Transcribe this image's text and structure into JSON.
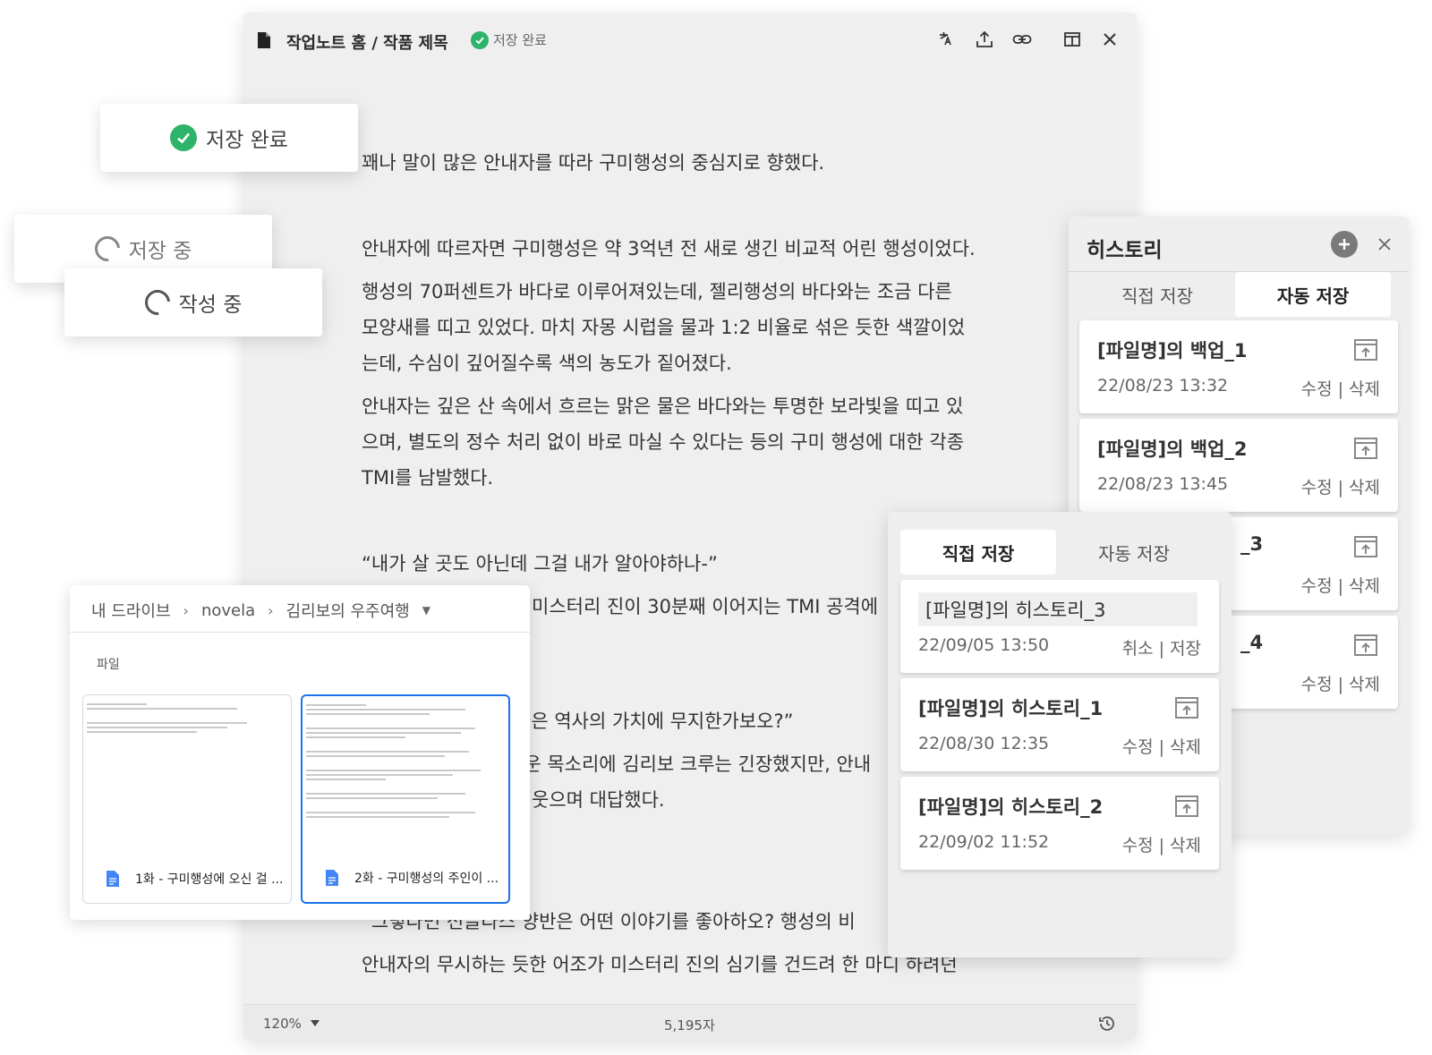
{
  "editor": {
    "title": "작업노트 홈 / 작품 제목",
    "save_status": "저장 완료",
    "paragraphs": [
      "꽤나 말이 많은 안내자를 따라 구미행성의 중심지로 향했다.",
      "",
      "안내자에 따르자면 구미행성은 약 3억년 전 새로 생긴 비교적 어린 행성이었다.",
      "행성의 70퍼센트가 바다로 이루어져있는데, 젤리행성의 바다와는 조금 다른",
      "모양새를 띠고 있었다. 마치 자몽 시럽을 물과 1:2 비율로 섞은 듯한 색깔이었",
      "는데, 수심이 깊어질수록 색의 농도가 짙어졌다.",
      "안내자는 깊은 산 속에서 흐르는 맑은 물은 바다와는 투명한 보라빛을 띠고 있",
      "으며, 별도의 정수 처리 없이 바로 마실 수 있다는 등의 구미 행성에 대한 각종",
      "TMI를 남발했다.",
      "",
      "“내가 살 곳도 아닌데 그걸 내가 알아야하나-”",
      "미스터리 진이 30분째 이어지는 TMI 공격에",
      "",
      "",
      "좋은 역사의 가치에 무지한가보오?”",
      "무운 목소리에 김리보 크루는 긴장했지만, 안내",
      "웃으며 대답했다.",
      "",
      "",
      "“그렇다면 선글라스 양반은 어떤 이야기를 좋아하오? 행성의 비",
      "안내자의 무시하는 듯한 어조가 미스터리 진의 심기를 건드려 한 마디 하려던"
    ],
    "footer": {
      "zoom": "120%",
      "char_count": "5,195자"
    }
  },
  "toasts": {
    "saved": "저장 완료",
    "saving": "저장 중",
    "writing": "작성 중"
  },
  "drive": {
    "breadcrumbs": [
      "내 드라이브",
      "novela",
      "김리보의 우주여행"
    ],
    "section_label": "파일",
    "files": [
      {
        "name": "1화 - 구미행성에 오신 걸 ..."
      },
      {
        "name": "2화 - 구미행성의 주인이 ..."
      }
    ]
  },
  "history_auto": {
    "title": "히스토리",
    "tabs": [
      "직접 저장",
      "자동 저장"
    ],
    "active_tab": "자동 저장",
    "items": [
      {
        "title": "[파일명]의 백업_1",
        "date": "22/08/23 13:32",
        "actions": "수정 | 삭제"
      },
      {
        "title": "[파일명]의 백업_2",
        "date": "22/08/23 13:45",
        "actions": "수정 | 삭제"
      },
      {
        "title": "_3",
        "date": "",
        "actions": "수정 | 삭제"
      },
      {
        "title": "_4",
        "date": "",
        "actions": "수정 | 삭제"
      }
    ]
  },
  "history_manual": {
    "tabs": [
      "직접 저장",
      "자동 저장"
    ],
    "active_tab": "직접 저장",
    "editing_item": {
      "title": "[파일명]의 히스토리_3",
      "date": "22/09/05 13:50",
      "actions": "취소 | 저장"
    },
    "items": [
      {
        "title": "[파일명]의 히스토리_1",
        "date": "22/08/30 12:35",
        "actions": "수정 | 삭제"
      },
      {
        "title": "[파일명]의 히스토리_2",
        "date": "22/09/02 11:52",
        "actions": "수정 | 삭제"
      }
    ]
  },
  "colors": {
    "success": "#2db36a",
    "selected_border": "#1a73e8",
    "file_icon": "#4285f4"
  }
}
